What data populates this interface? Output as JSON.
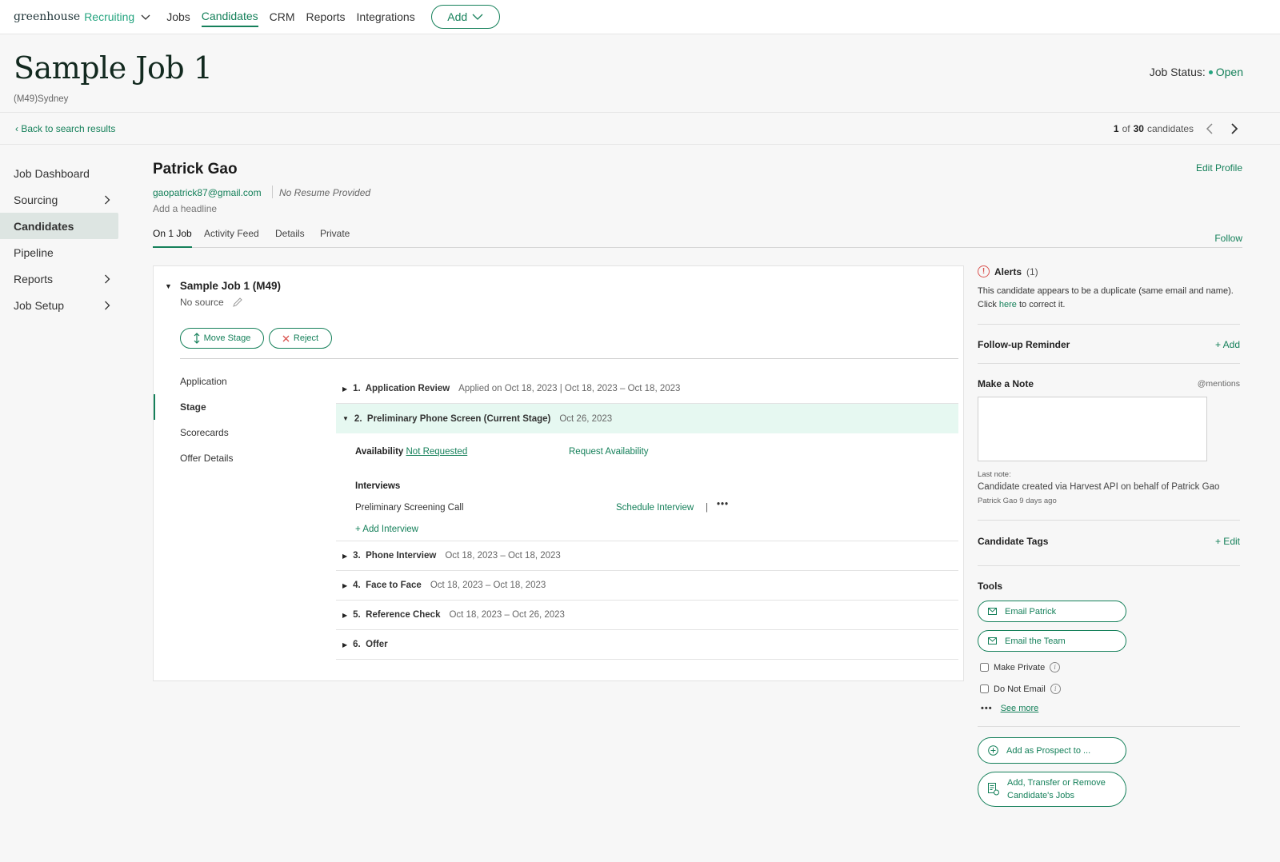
{
  "nav": {
    "brand": "greenhouse",
    "brand_product": "Recruiting",
    "items": [
      "Jobs",
      "Candidates",
      "CRM",
      "Reports",
      "Integrations"
    ],
    "active": "Candidates",
    "add_label": "Add"
  },
  "job": {
    "title": "Sample Job 1",
    "subtitle": "(M49)Sydney",
    "status_label": "Job Status:",
    "status_value": "Open"
  },
  "crumb": {
    "back_label": "Back to search results",
    "pager_current": "1",
    "pager_of": "of",
    "pager_total": "30",
    "pager_suffix": "candidates"
  },
  "sidebar": {
    "items": [
      {
        "label": "Job Dashboard",
        "has_chevron": false
      },
      {
        "label": "Sourcing",
        "has_chevron": true
      },
      {
        "label": "Candidates",
        "has_chevron": false
      },
      {
        "label": "Pipeline",
        "has_chevron": false
      },
      {
        "label": "Reports",
        "has_chevron": true
      },
      {
        "label": "Job Setup",
        "has_chevron": true
      }
    ],
    "active": "Candidates"
  },
  "candidate": {
    "name": "Patrick Gao",
    "email": "gaopatrick87@gmail.com",
    "resume": "No Resume Provided",
    "headline_placeholder": "Add a headline",
    "edit_profile": "Edit Profile",
    "follow": "Follow",
    "tabs": [
      "On 1 Job",
      "Activity Feed",
      "Details",
      "Private"
    ],
    "active_tab": "On 1 Job"
  },
  "jobcard": {
    "title": "Sample Job 1 (M49)",
    "source": "No source",
    "move_stage": "Move Stage",
    "reject": "Reject",
    "subnav": [
      "Application",
      "Stage",
      "Scorecards",
      "Offer Details"
    ],
    "subnav_active": "Stage",
    "stages": [
      {
        "num": "1.",
        "name": "Application Review",
        "meta": "Applied on Oct 18, 2023 | Oct 18, 2023 – Oct 18, 2023"
      },
      {
        "num": "2.",
        "name": "Preliminary Phone Screen (Current Stage)",
        "meta": "Oct 26, 2023"
      },
      {
        "num": "3.",
        "name": "Phone Interview",
        "meta": "Oct 18, 2023 – Oct 18, 2023"
      },
      {
        "num": "4.",
        "name": "Face to Face",
        "meta": "Oct 18, 2023 – Oct 18, 2023"
      },
      {
        "num": "5.",
        "name": "Reference Check",
        "meta": "Oct 18, 2023 – Oct 26, 2023"
      },
      {
        "num": "6.",
        "name": "Offer",
        "meta": ""
      }
    ],
    "current": {
      "availability_label": "Availability",
      "availability_value": "Not Requested",
      "request_availability": "Request Availability",
      "interviews_label": "Interviews",
      "interview_name": "Preliminary Screening Call",
      "schedule_interview": "Schedule Interview",
      "more": "•••",
      "add_interview": "+ Add Interview"
    }
  },
  "right": {
    "alerts_label": "Alerts",
    "alerts_count": "(1)",
    "alert_text_1": "This candidate appears to be a duplicate (same email and name).",
    "alert_click": "Click",
    "alert_here": "here",
    "alert_text_2": "to correct it.",
    "followup_label": "Follow-up Reminder",
    "followup_add": "+ Add",
    "note_label": "Make a Note",
    "mentions": "@mentions",
    "last_note_label": "Last note:",
    "last_note": "Candidate created via Harvest API on behalf of Patrick Gao",
    "last_note_by": "Patrick Gao 9 days ago",
    "tags_label": "Candidate Tags",
    "tags_edit": "+ Edit",
    "tools_label": "Tools",
    "email_patrick": "Email Patrick",
    "email_team": "Email the Team",
    "make_private": "Make Private",
    "do_not_email": "Do Not Email",
    "see_more": "See more",
    "add_prospect": "Add as Prospect to ...",
    "transfer_1": "Add, Transfer or Remove",
    "transfer_2": "Candidate's Jobs"
  },
  "colors": {
    "brand": "#15805a",
    "alert": "#d9534f",
    "current_stage_bg": "#e6f8f1"
  }
}
